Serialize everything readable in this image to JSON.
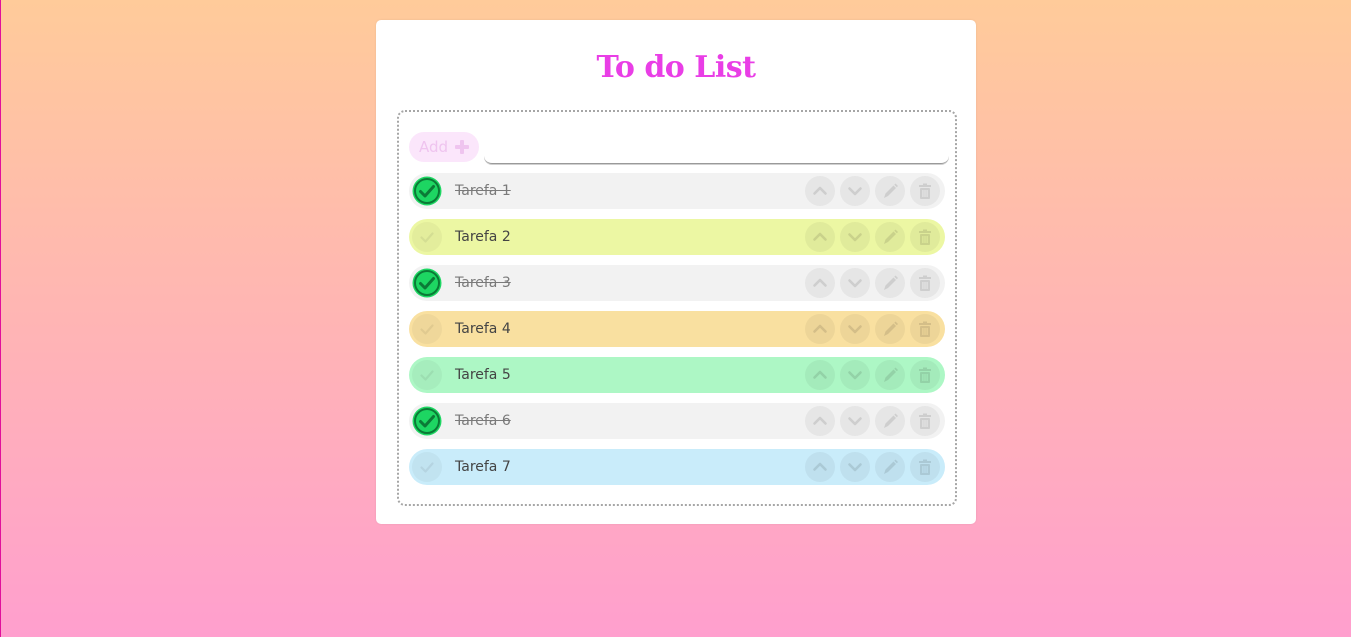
{
  "app": {
    "title": "To do List"
  },
  "add": {
    "button_label": "Add",
    "input_value": "",
    "input_placeholder": ""
  },
  "tasks": [
    {
      "label": "Tarefa 1",
      "done": true,
      "color": "#f2f2f2"
    },
    {
      "label": "Tarefa 2",
      "done": false,
      "color": "#ecf7a3"
    },
    {
      "label": "Tarefa 3",
      "done": true,
      "color": "#f2f2f2"
    },
    {
      "label": "Tarefa 4",
      "done": false,
      "color": "#f9e0a0"
    },
    {
      "label": "Tarefa 5",
      "done": false,
      "color": "#adf7c5"
    },
    {
      "label": "Tarefa 6",
      "done": true,
      "color": "#f2f2f2"
    },
    {
      "label": "Tarefa 7",
      "done": false,
      "color": "#c9ecfa"
    }
  ],
  "icons": {
    "check": "check-circle-icon",
    "up": "chevron-up-icon",
    "down": "chevron-down-icon",
    "edit": "pencil-icon",
    "delete": "trash-icon",
    "add": "plus-icon"
  },
  "colors": {
    "title": "#e93ee6",
    "check_done": "#1dd662",
    "add_button_bg": "#fbe6fb",
    "add_button_text": "#efc4ef"
  }
}
